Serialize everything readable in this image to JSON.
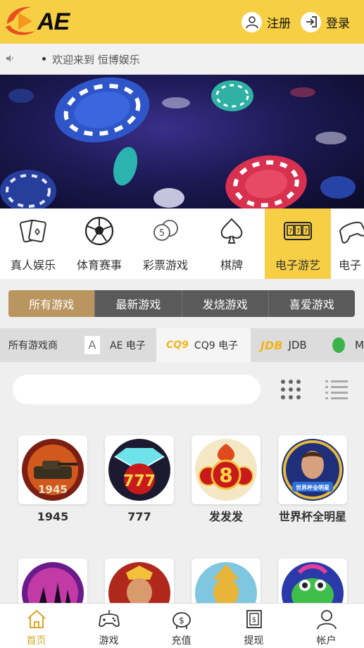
{
  "header": {
    "logo_text": "AE",
    "register_label": "注册",
    "login_label": "登录"
  },
  "notice": {
    "text": "欢迎来到 恒博娱乐"
  },
  "categories": [
    {
      "label": "真人娱乐",
      "icon": "cards-icon"
    },
    {
      "label": "体育赛事",
      "icon": "soccer-ball-icon"
    },
    {
      "label": "彩票游戏",
      "icon": "lottery-icon"
    },
    {
      "label": "棋牌",
      "icon": "spade-icon"
    },
    {
      "label": "电子游艺",
      "icon": "slot-machine-icon",
      "active": true
    },
    {
      "label": "电子",
      "icon": "gamepad-icon"
    }
  ],
  "tabs": [
    {
      "label": "所有游戏",
      "active": true
    },
    {
      "label": "最新游戏"
    },
    {
      "label": "发烧游戏"
    },
    {
      "label": "喜爱游戏"
    }
  ],
  "providers": {
    "all_label": "所有游戏商",
    "items": [
      {
        "label": "AE 电子",
        "logo": "A"
      },
      {
        "label": "CQ9 电子",
        "logo": "CQ9",
        "active": true
      },
      {
        "label": "JDB",
        "logo": "JDB"
      },
      {
        "label": "M",
        "logo": "M"
      }
    ]
  },
  "search": {
    "placeholder": ""
  },
  "games": [
    {
      "name": "1945",
      "thumb_label": "1945"
    },
    {
      "name": "777",
      "thumb_label": "777"
    },
    {
      "name": "发发发",
      "thumb_label": "8"
    },
    {
      "name": "世界杯全明星",
      "thumb_label": "世界杯全明星"
    }
  ],
  "bottom_nav": [
    {
      "label": "首页",
      "icon": "home-icon",
      "active": true
    },
    {
      "label": "游戏",
      "icon": "gamepad-icon"
    },
    {
      "label": "充值",
      "icon": "piggy-bank-icon"
    },
    {
      "label": "提现",
      "icon": "withdraw-icon"
    },
    {
      "label": "帐户",
      "icon": "user-icon"
    }
  ],
  "colors": {
    "header_yellow": "#f7cf45",
    "tab_active": "#b99560",
    "tab_inactive": "#5a5a5a",
    "nav_active": "#d9a728"
  }
}
